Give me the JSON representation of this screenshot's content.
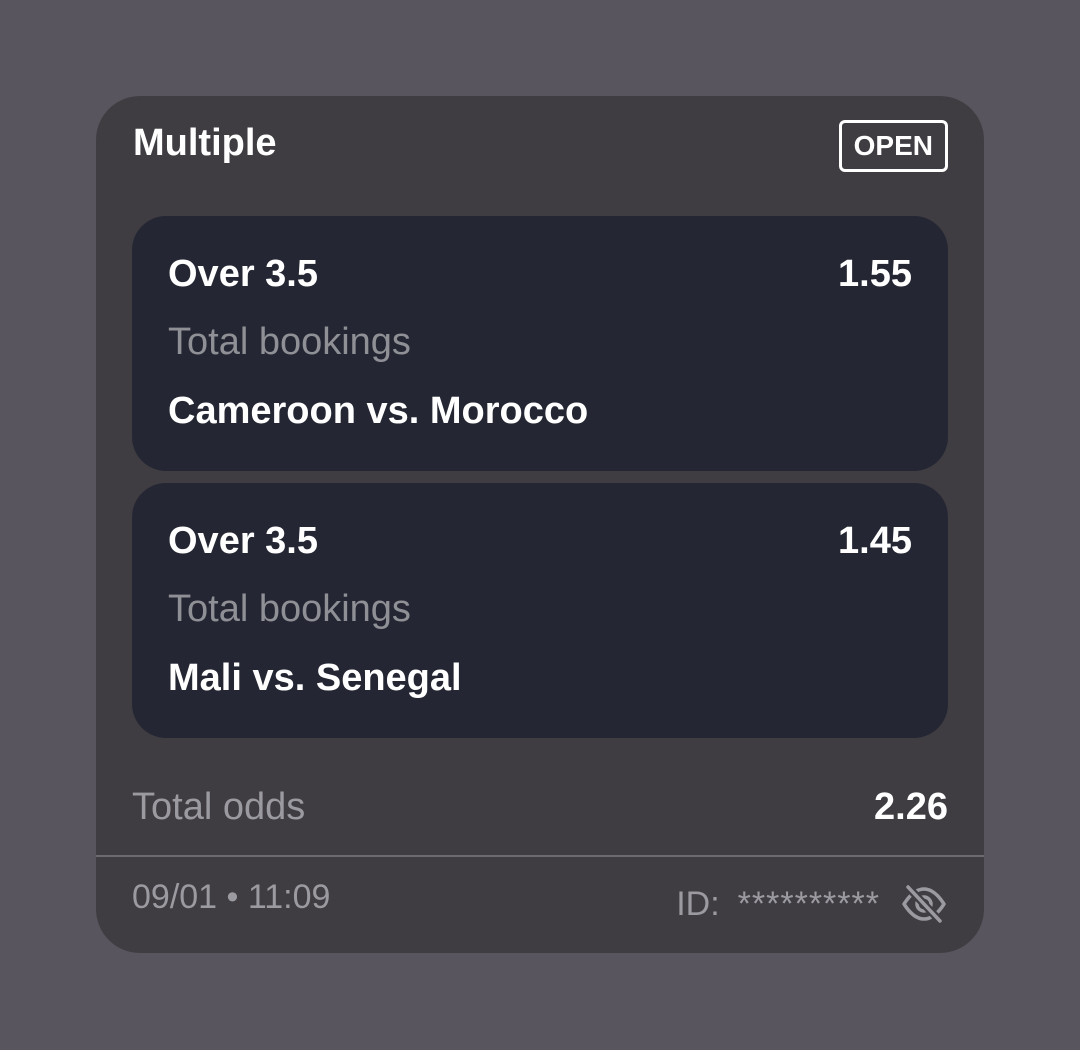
{
  "ticket": {
    "title": "Multiple",
    "status": "OPEN"
  },
  "selections": [
    {
      "market": "Over 3.5",
      "odds": "1.55",
      "type": "Total bookings",
      "match": "Cameroon vs. Morocco"
    },
    {
      "market": "Over 3.5",
      "odds": "1.45",
      "type": "Total bookings",
      "match": "Mali vs. Senegal"
    }
  ],
  "summary": {
    "total_label": "Total odds",
    "total_value": "2.26"
  },
  "footer": {
    "timestamp": "09/01 • 11:09",
    "id_label": "ID:",
    "id_value": "**********",
    "toggle_icon": "eye-off-icon"
  },
  "colors": {
    "page_bg": "#58555f",
    "card_bg": "#403d42",
    "selection_bg": "#242733",
    "muted_text": "#9a9aa0",
    "text": "#ffffff"
  }
}
